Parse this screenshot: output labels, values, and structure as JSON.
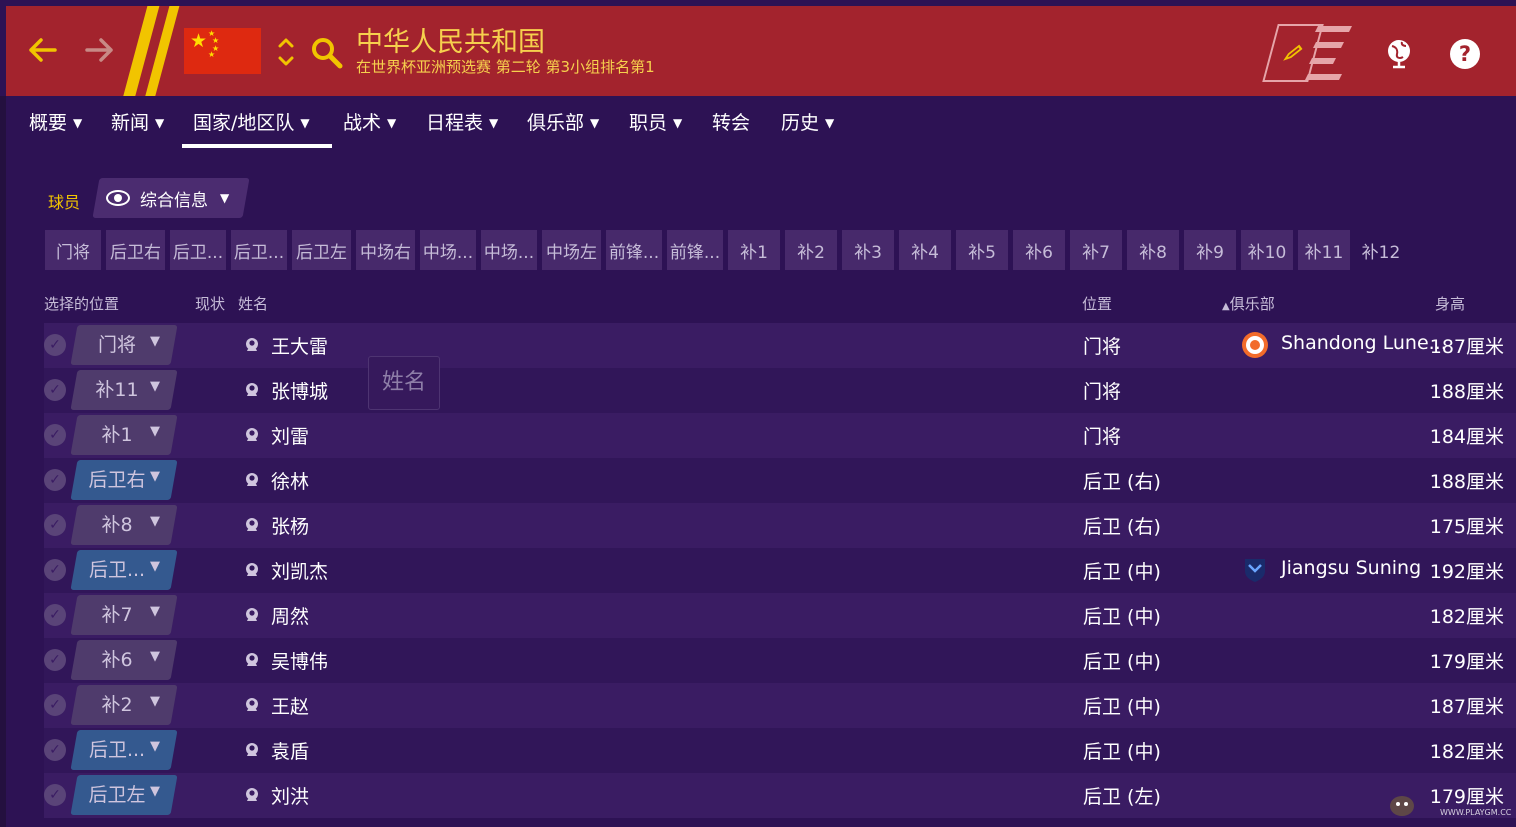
{
  "header": {
    "title": "中华人民共和国",
    "subtitle": "在世界杯亚洲预选赛 第二轮 第3小组排名第1",
    "colors": {
      "accent": "#f1c400",
      "header_bg": "#a3232d",
      "page_bg": "#2d1254"
    }
  },
  "nav": {
    "items": [
      "概要",
      "新闻",
      "国家/地区队",
      "战术",
      "日程表",
      "俱乐部",
      "职员",
      "转会",
      "历史"
    ],
    "active": "国家/地区队"
  },
  "filter": {
    "label": "球员",
    "view_label": "综合信息"
  },
  "position_tabs": [
    "门将",
    "后卫右",
    "后卫...",
    "后卫...",
    "后卫左",
    "中场右",
    "中场...",
    "中场...",
    "中场左",
    "前锋...",
    "前锋...",
    "补1",
    "补2",
    "补3",
    "补4",
    "补5",
    "补6",
    "补7",
    "补8",
    "补9",
    "补10",
    "补11",
    "补12"
  ],
  "table": {
    "headers": {
      "selected_position": "选择的位置",
      "status": "现状",
      "name": "姓名",
      "position": "位置",
      "club": "俱乐部",
      "height": "身高"
    },
    "rows": [
      {
        "sel": "门将",
        "name": "王大雷",
        "position": "门将",
        "club": "Shandong Lune...",
        "height": "187厘米"
      },
      {
        "sel": "补11",
        "name": "张博城",
        "position": "门将",
        "club": "",
        "height": "188厘米"
      },
      {
        "sel": "补1",
        "name": "刘雷",
        "position": "门将",
        "club": "",
        "height": "184厘米"
      },
      {
        "sel": "后卫右",
        "name": "徐林",
        "position": "后卫 (右)",
        "club": "",
        "height": "188厘米"
      },
      {
        "sel": "补8",
        "name": "张杨",
        "position": "后卫 (右)",
        "club": "",
        "height": "175厘米"
      },
      {
        "sel": "后卫...",
        "name": "刘凯杰",
        "position": "后卫 (中)",
        "club": "Jiangsu Suning",
        "height": "192厘米"
      },
      {
        "sel": "补7",
        "name": "周然",
        "position": "后卫 (中)",
        "club": "",
        "height": "182厘米"
      },
      {
        "sel": "补6",
        "name": "吴博伟",
        "position": "后卫 (中)",
        "club": "",
        "height": "179厘米"
      },
      {
        "sel": "补2",
        "name": "王赵",
        "position": "后卫 (中)",
        "club": "",
        "height": "187厘米"
      },
      {
        "sel": "后卫...",
        "name": "袁盾",
        "position": "后卫 (中)",
        "club": "",
        "height": "182厘米"
      },
      {
        "sel": "后卫左",
        "name": "刘洪",
        "position": "后卫 (左)",
        "club": "",
        "height": "179厘米"
      }
    ]
  },
  "tooltip": {
    "text": "姓名"
  },
  "watermark": {
    "text": "WWW.PLAYGM.CC"
  }
}
